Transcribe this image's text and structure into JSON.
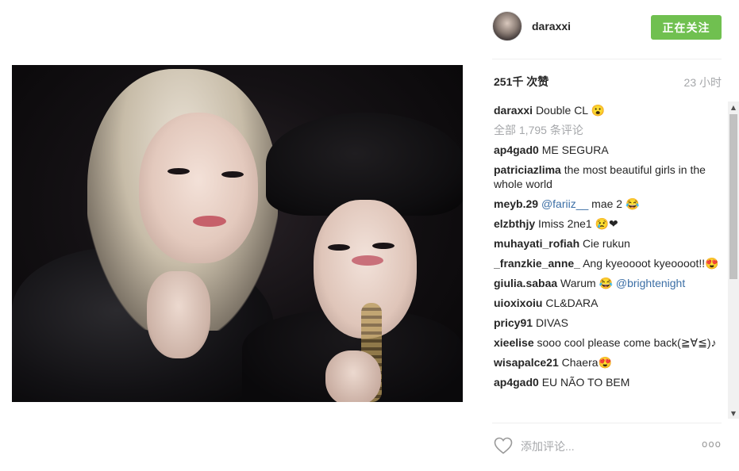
{
  "post": {
    "username": "daraxxi",
    "follow_label": "正在关注",
    "likes": "251千 次赞",
    "time": "23 小时"
  },
  "comments": [
    {
      "user": "daraxxi",
      "text": "Double CL 😮"
    },
    {
      "view_all": "全部 1,795 条评论"
    },
    {
      "user": "ap4gad0",
      "text": "ME SEGURA"
    },
    {
      "user": "patriciazlima",
      "text": "the most beautiful girls in the whole world"
    },
    {
      "user": "meyb.29",
      "mention": "@fariiz__",
      "text": "mae 2 😂"
    },
    {
      "user": "elzbthjy",
      "text": "Imiss 2ne1 😢❤"
    },
    {
      "user": "muhayati_rofiah",
      "text": "Cie rukun"
    },
    {
      "user": "_franzkie_anne_",
      "text": "Ang kyeoooot kyeoooot!!😍"
    },
    {
      "user": "giulia.sabaa",
      "text": "Warum 😂",
      "mention": "@brightenight"
    },
    {
      "user": "uioxixoiu",
      "text": "CL&DARA"
    },
    {
      "user": "pricy91",
      "text": "DIVAS"
    },
    {
      "user": "xieelise",
      "text": "sooo cool please come back(≧∀≦)♪"
    },
    {
      "user": "wisapalce21",
      "text": "Chaera😍"
    },
    {
      "user": "ap4gad0",
      "text": "EU NÃO TO BEM"
    }
  ],
  "footer": {
    "add_comment_placeholder": "添加评论...",
    "more_label": "ooo"
  },
  "icons": {
    "heart": "heart-icon",
    "more": "more-options-icon"
  },
  "colors": {
    "follow_button": "#70c050",
    "mention": "#3b6ea5",
    "muted": "#a5a7aa"
  }
}
